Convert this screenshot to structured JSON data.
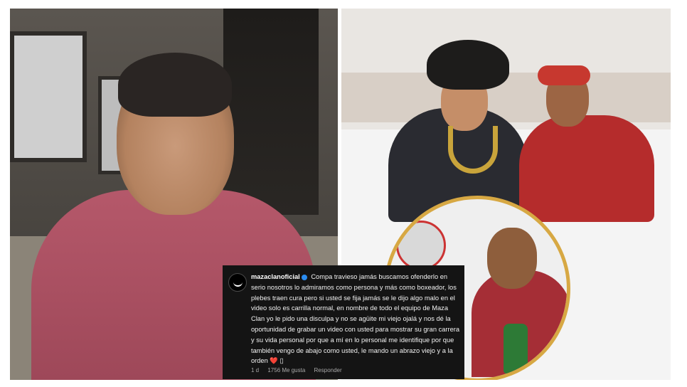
{
  "comment": {
    "username": "mazaclanoficial",
    "body": "Compa travieso jamás buscamos ofenderlo en serio nosotros lo admiramos como persona y más como boxeador, los plebes traen cura pero si usted se fija jamás se le dijo algo malo en el video solo es carrilla normal, en nombre de todo el equipo de Maza Clan yo le pido una disculpa y no se agüite mi viejo ojalá y nos dé la oportunidad de grabar un video con usted para mostrar su gran carrera y su vida personal por que a mí en lo personal me identifique por que también vengo de abajo como usted, le mando un abrazo viejo y a la orden",
    "heart": "❤️",
    "trailing": "▯",
    "time": "1 d",
    "likes": "1756 Me gusta",
    "reply": "Responder"
  },
  "colors": {
    "card_bg": "#141414",
    "verified": "#2a8cf0",
    "heart": "#e0242e",
    "inset_border": "#d7a843"
  }
}
